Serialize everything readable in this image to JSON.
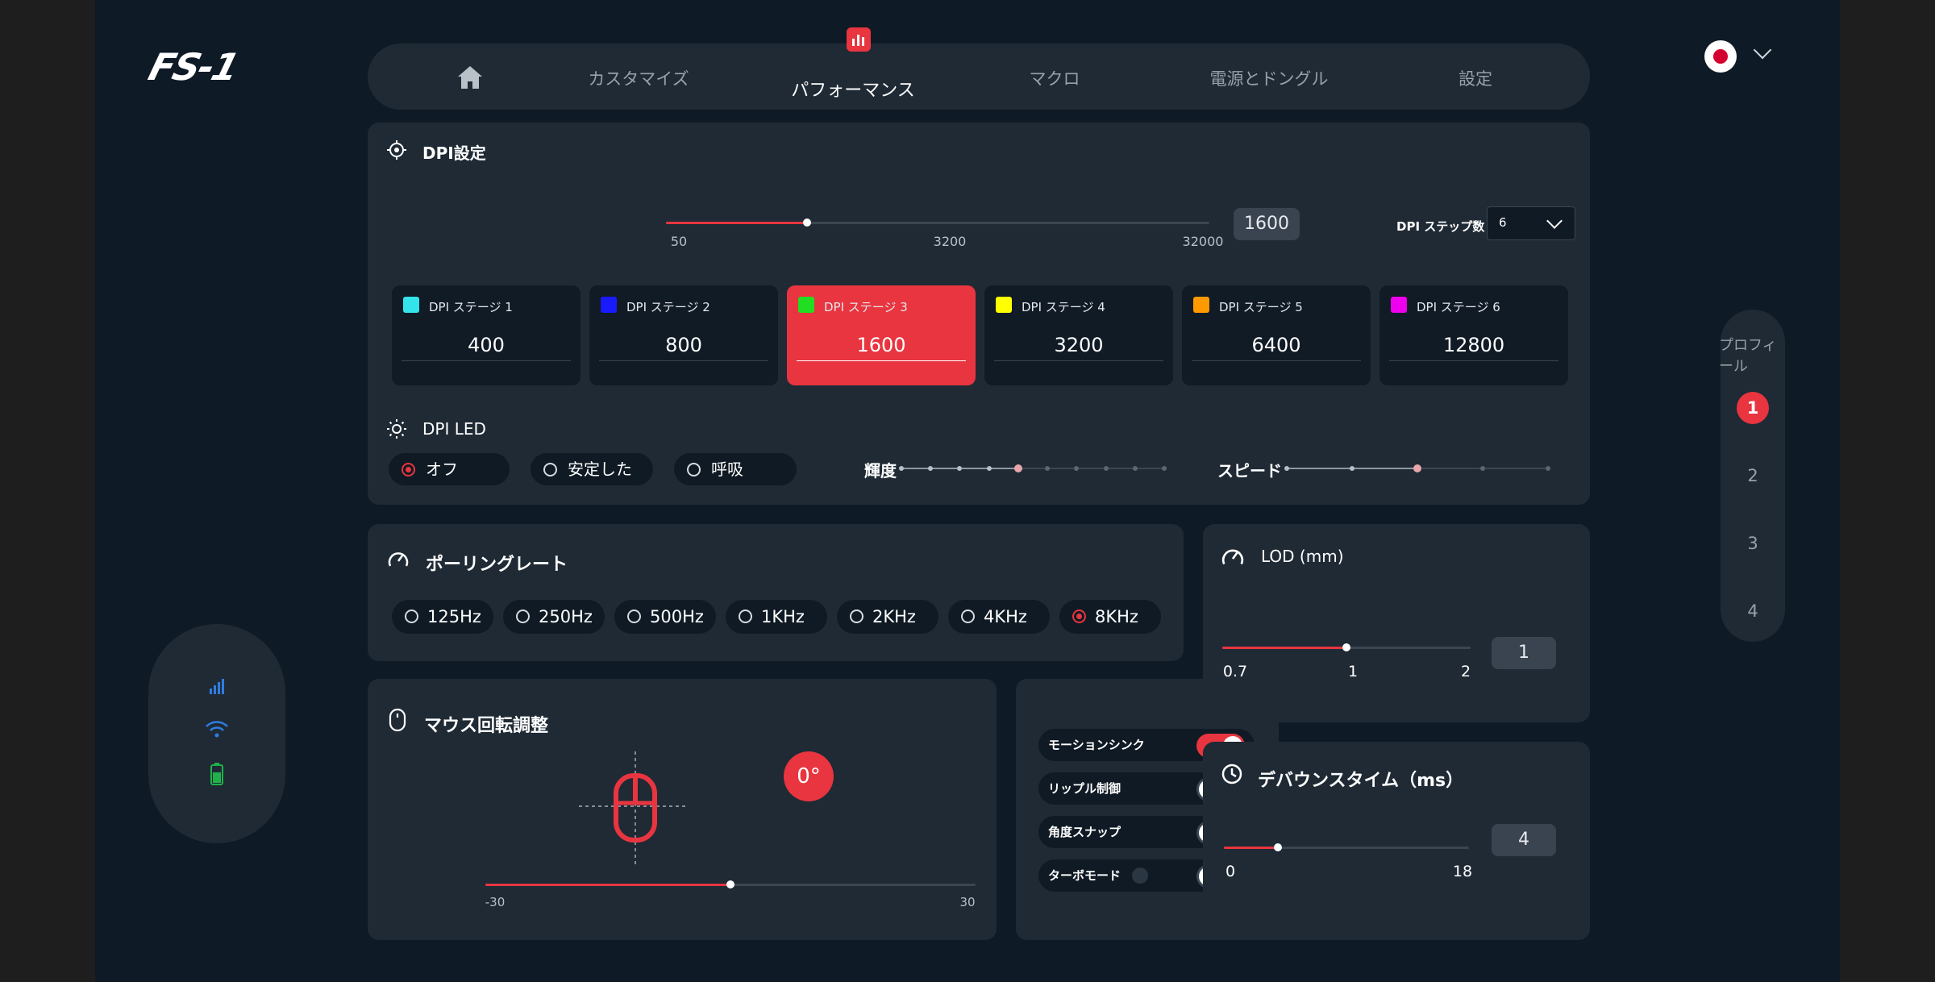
{
  "brand": {
    "logo": "FS-1"
  },
  "nav": {
    "tabs": [
      {
        "label": "カスタマイズ"
      },
      {
        "label": "パフォーマンス"
      },
      {
        "label": "マクロ"
      },
      {
        "label": "電源とドングル"
      },
      {
        "label": "設定"
      }
    ],
    "active": "パフォーマンス"
  },
  "dpi": {
    "title": "DPI設定",
    "slider": {
      "min_label": "50",
      "mid_label": "3200",
      "max_label": "32000",
      "value": "1600",
      "fraction": 0.26
    },
    "step_count_label": "DPI ステップ数",
    "step_count_value": "6",
    "stages": [
      {
        "label": "DPI ステージ 1",
        "value": "400",
        "color": "#33e4ea"
      },
      {
        "label": "DPI ステージ 2",
        "value": "800",
        "color": "#1a1aff"
      },
      {
        "label": "DPI ステージ 3",
        "value": "1600",
        "color": "#22dd22",
        "active": true
      },
      {
        "label": "DPI ステージ 4",
        "value": "3200",
        "color": "#ffff00"
      },
      {
        "label": "DPI ステージ 5",
        "value": "6400",
        "color": "#ff9900"
      },
      {
        "label": "DPI ステージ 6",
        "value": "12800",
        "color": "#ee00ee"
      }
    ]
  },
  "dpi_led": {
    "title": "DPI LED",
    "modes": [
      {
        "label": "オフ",
        "selected": true
      },
      {
        "label": "安定した"
      },
      {
        "label": "呼吸"
      }
    ],
    "brightness_label": "輝度",
    "brightness_level": 0.45,
    "speed_label": "スピード",
    "speed_level": 0.5
  },
  "polling": {
    "title": "ポーリングレート",
    "options": [
      {
        "label": "125Hz"
      },
      {
        "label": "250Hz"
      },
      {
        "label": "500Hz"
      },
      {
        "label": "1KHz"
      },
      {
        "label": "2KHz"
      },
      {
        "label": "4KHz"
      },
      {
        "label": "8KHz",
        "selected": true
      }
    ]
  },
  "lod": {
    "title": "LOD (mm)",
    "min_label": "0.7",
    "mid_label": "1",
    "max_label": "2",
    "value": "1",
    "fraction": 0.5
  },
  "rotation": {
    "title": "マウス回転調整",
    "angle": "0°",
    "min_label": "-30",
    "max_label": "30",
    "fraction": 0.5
  },
  "toggles": [
    {
      "label": "モーションシンク",
      "on": true
    },
    {
      "label": "リップル制御",
      "on": false
    },
    {
      "label": "角度スナップ",
      "on": false
    },
    {
      "label": "ターボモード",
      "on": false
    }
  ],
  "debounce": {
    "title": "デバウンスタイム（ms）",
    "min_label": "0",
    "max_label": "18",
    "value": "4",
    "fraction": 0.22
  },
  "profile": {
    "label": "プロフィール",
    "items": [
      {
        "label": "1",
        "active": true
      },
      {
        "label": "2"
      },
      {
        "label": "3"
      },
      {
        "label": "4"
      }
    ]
  },
  "colors": {
    "accent": "#e8353f",
    "panel": "#1f2a35",
    "background": "#0e1b26"
  }
}
